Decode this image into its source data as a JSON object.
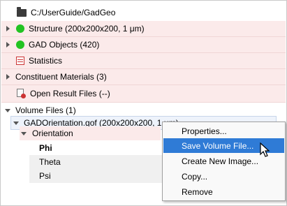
{
  "tree": {
    "root_path": "C:/UserGuide/GadGeo",
    "items": [
      {
        "label": "Structure (200x200x200, 1 μm)"
      },
      {
        "label": "GAD Objects (420)"
      },
      {
        "label": "Statistics"
      },
      {
        "label": "Constituent Materials (3)"
      },
      {
        "label": "Open Result Files (--)"
      },
      {
        "label": "Volume Files (1)"
      }
    ],
    "volume_file": "GADOrientation.gof (200x200x200, 1 μm)",
    "orientation": "Orientation",
    "params": [
      "Phi",
      "Theta",
      "Psi"
    ]
  },
  "context_menu": {
    "items": [
      "Properties...",
      "Save Volume File...",
      "Create New Image...",
      "Copy...",
      "Remove"
    ],
    "highlighted_index": 1,
    "highlight_color": "#2f7bd6"
  }
}
